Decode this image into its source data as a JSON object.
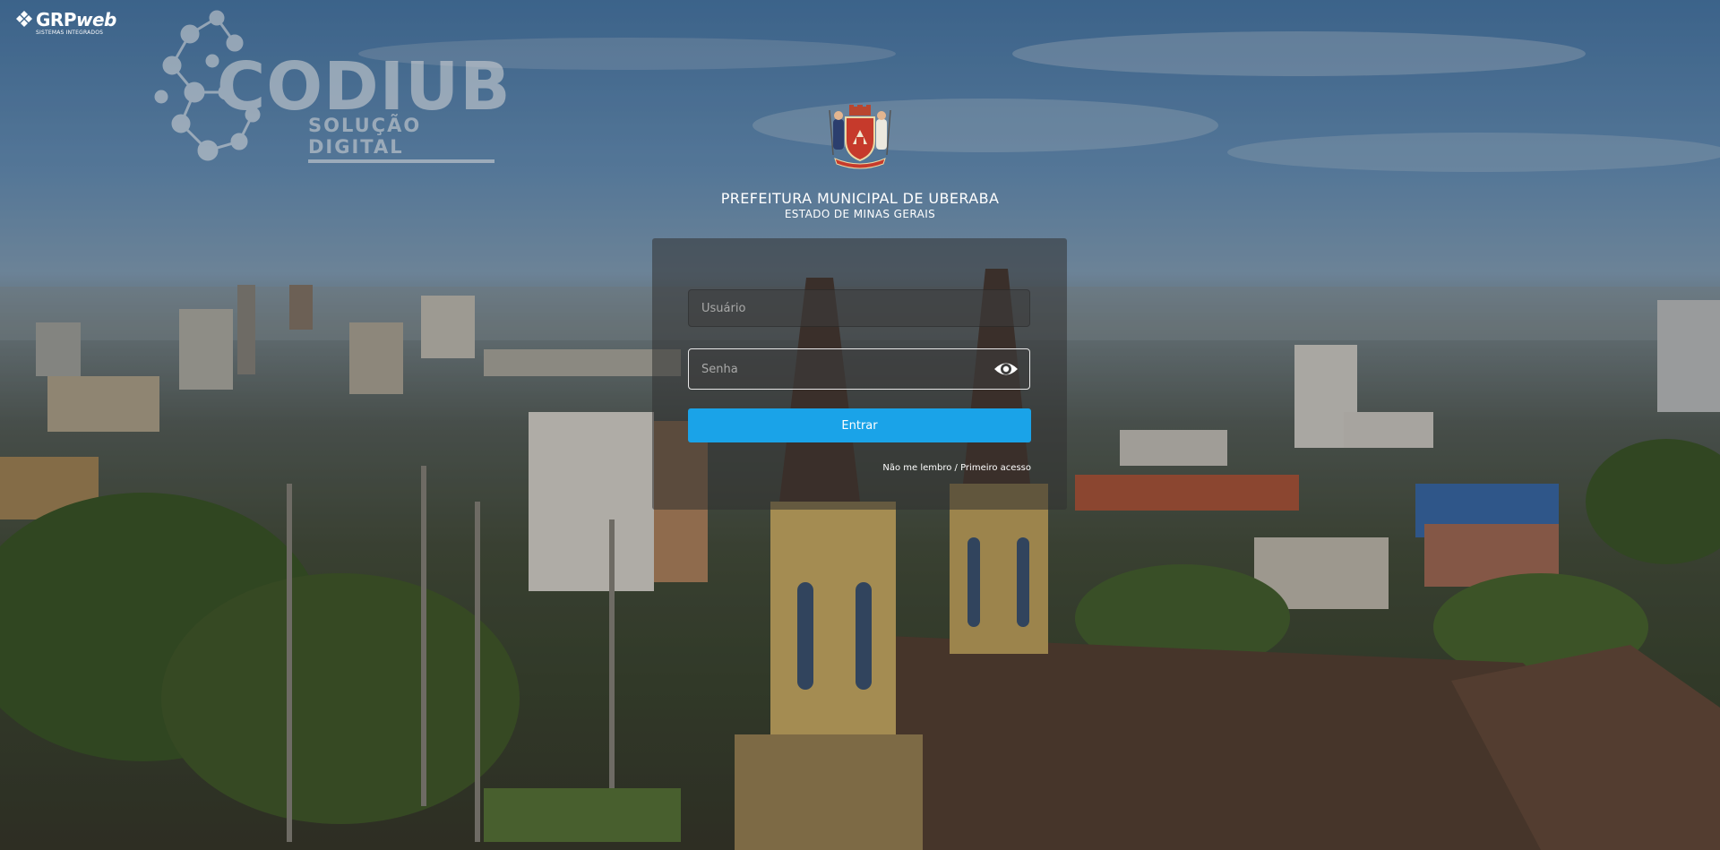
{
  "brand": {
    "grp_name_a": "GRP",
    "grp_name_b": "web",
    "grp_sub": "SISTEMAS INTEGRADOS",
    "codiub_title": "CODIUB",
    "codiub_sub": "SOLUÇÃO DIGITAL"
  },
  "header": {
    "title": "PREFEITURA MUNICIPAL DE UBERABA",
    "subtitle": "ESTADO DE MINAS GERAIS"
  },
  "login": {
    "username_placeholder": "Usuário",
    "password_placeholder": "Senha",
    "submit_label": "Entrar",
    "forgot_link": "Não me lembro / Primeiro acesso"
  },
  "colors": {
    "accent": "#1aa3e8",
    "card": "rgba(50,50,50,0.55)"
  },
  "icons": {
    "password_toggle": "eye-icon",
    "brand_mark": "diamond-icon"
  }
}
